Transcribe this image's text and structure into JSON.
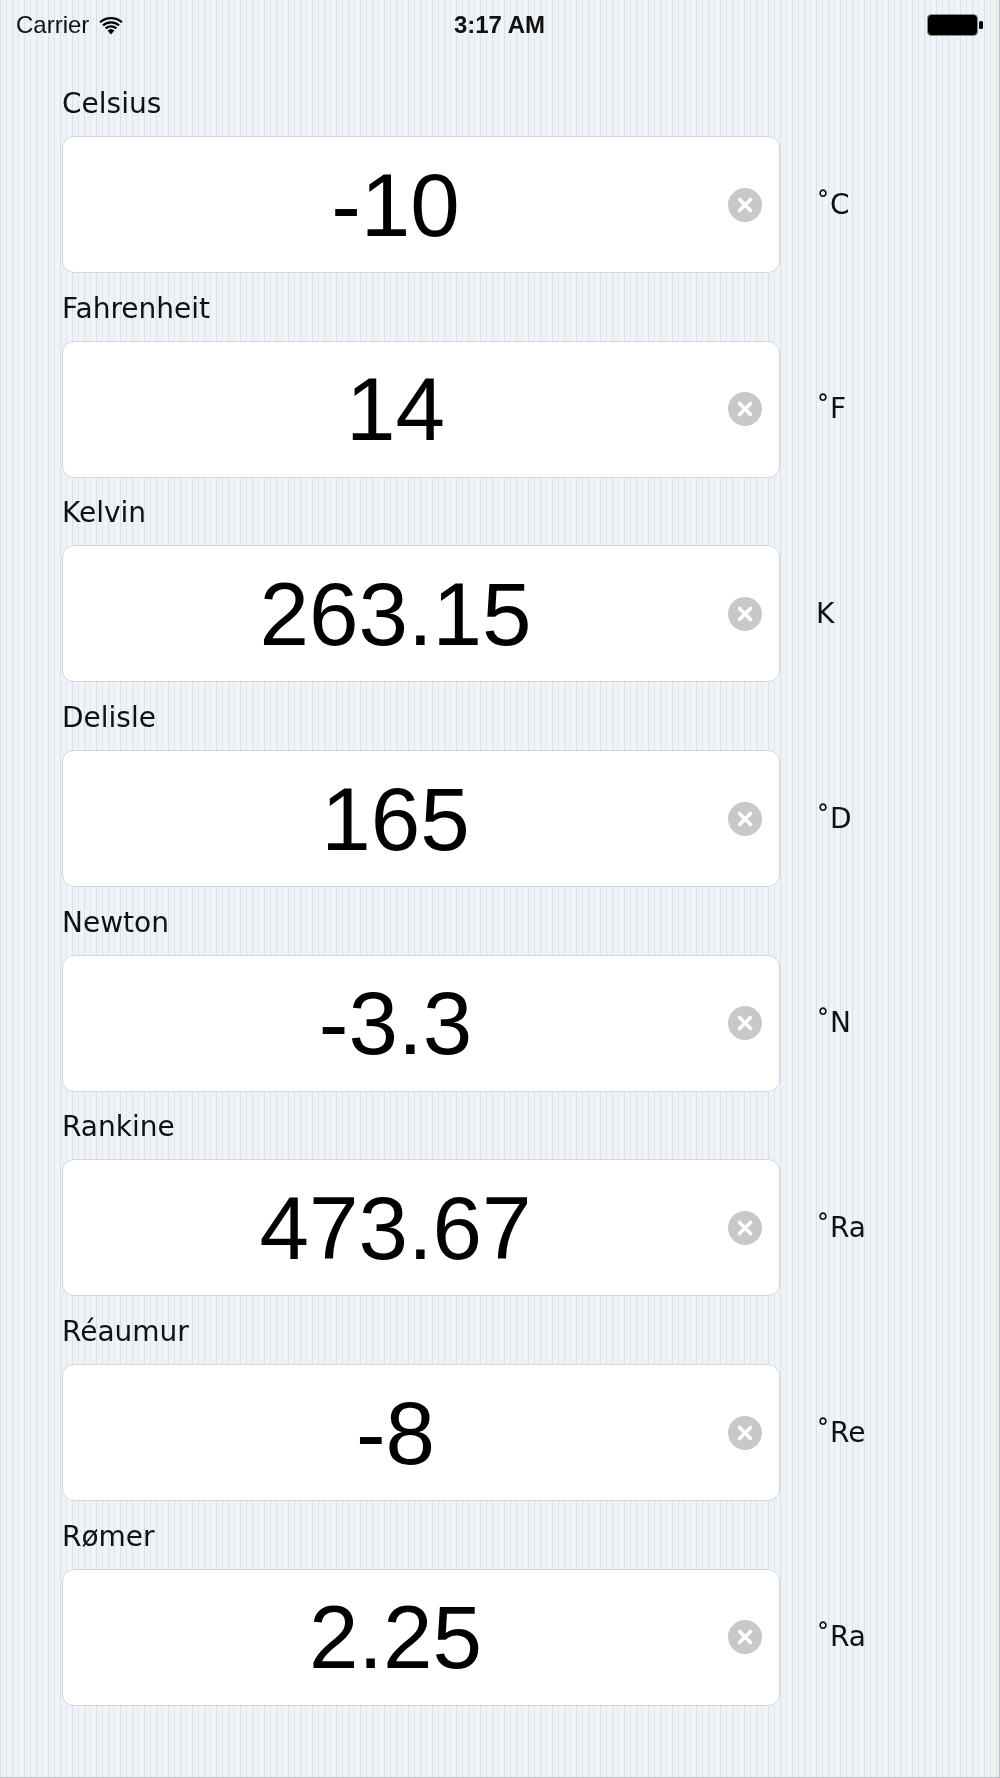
{
  "status_bar": {
    "carrier": "Carrier",
    "time": "3:17 AM"
  },
  "scales": [
    {
      "label": "Celsius",
      "value": "-10",
      "unit": "˚C"
    },
    {
      "label": "Fahrenheit",
      "value": "14",
      "unit": "˚F"
    },
    {
      "label": "Kelvin",
      "value": "263.15",
      "unit": "K"
    },
    {
      "label": "Delisle",
      "value": "165",
      "unit": "˚D"
    },
    {
      "label": "Newton",
      "value": "-3.3",
      "unit": "˚N"
    },
    {
      "label": "Rankine",
      "value": "473.67",
      "unit": "˚Ra"
    },
    {
      "label": "Réaumur",
      "value": "-8",
      "unit": "˚Re"
    },
    {
      "label": "Rømer",
      "value": "2.25",
      "unit": "˚Ra"
    }
  ]
}
